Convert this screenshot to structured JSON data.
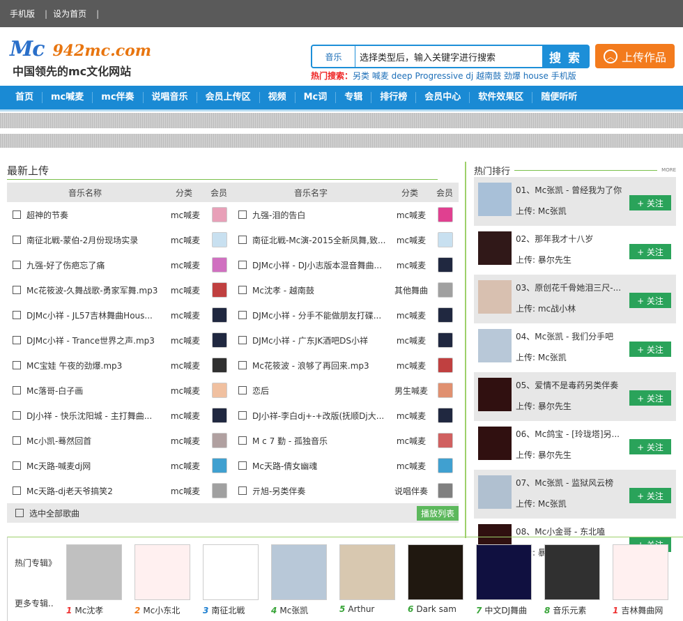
{
  "top": {
    "mobile": "手机版",
    "homepage": "设为首页",
    "sep": "|"
  },
  "logo": {
    "mc": "Mc",
    "domain": "942mc.com",
    "slogan": "中国领先的mc文化网站"
  },
  "search": {
    "type": "音乐",
    "value": "选择类型后，输入关键字进行搜索",
    "button": "搜 索"
  },
  "hot": {
    "label": "热门搜索：",
    "terms": "另类 喊麦 deep Progressive dj 越南鼓 劲爆 house 手机版"
  },
  "upload": {
    "label": "上传作品",
    "icon": "up-arrow-icon"
  },
  "nav": [
    "首页",
    "mc喊麦",
    "mc伴奏",
    "说唱音乐",
    "会员上传区",
    "视频",
    "Mc词",
    "专辑",
    "排行榜",
    "会员中心",
    "软件效果区",
    "随便听听"
  ],
  "latest": {
    "title": "最新上传",
    "headers": {
      "name1": "音乐名称",
      "cat1": "分类",
      "member1": "会员",
      "name2": "音乐名字",
      "cat2": "分类",
      "member2": "会员"
    },
    "rows": [
      {
        "l": "超神的节奏",
        "lc": "mc喊麦",
        "r": "九强-泪的告白",
        "rc": "mc喊麦"
      },
      {
        "l": "南征北戦-蒙伯-2月份现场实录",
        "lc": "mc喊麦",
        "r": "南征北戦-Mc演-2015全新凤舞,致...",
        "rc": "mc喊麦"
      },
      {
        "l": "九强-好了伤疤忘了痛",
        "lc": "mc喊麦",
        "r": "DJMc小祥 - DJ小志版本混音舞曲...",
        "rc": "mc喊麦"
      },
      {
        "l": "Mc花筱波-久舞战歌-勇家军舞.mp3",
        "lc": "mc喊麦",
        "r": "Mc沈孝 - 越南鼓",
        "rc": "其他舞曲"
      },
      {
        "l": "DJMc小祥 - JL57吉林舞曲Hous...",
        "lc": "mc喊麦",
        "r": "DJMc小祥 - 分手不能做朋友打碟...",
        "rc": "mc喊麦"
      },
      {
        "l": "DJMc小祥 - Trance世界之声.mp3",
        "lc": "mc喊麦",
        "r": "DJMc小祥 - 广东JK酒吧DS小祥",
        "rc": "mc喊麦"
      },
      {
        "l": "MC宝娃 午夜的劲爆.mp3",
        "lc": "mc喊麦",
        "r": "Mc花筱波 - 浪够了再回来.mp3",
        "rc": "mc喊麦"
      },
      {
        "l": "Mc落哥-白子画",
        "lc": "mc喊麦",
        "r": "恋后",
        "rc": "男生喊麦"
      },
      {
        "l": "DJ小祥 - 快乐沈阳城 - 主打舞曲...",
        "lc": "mc喊麦",
        "r": "DJ小祥-李白dj+-+改版(抚顺Dj大...",
        "rc": "mc喊麦"
      },
      {
        "l": "Mc小凯-蓦然回首",
        "lc": "mc喊麦",
        "r": "M c 7 勤 - 孤独音乐",
        "rc": "mc喊麦"
      },
      {
        "l": "Mc天路-喊麦dj网",
        "lc": "mc喊麦",
        "r": "Mc天路-倩女幽魂",
        "rc": "mc喊麦"
      },
      {
        "l": "Mc天路-dj老天爷搞笑2",
        "lc": "mc喊麦",
        "r": "亓旭-另类伴奏",
        "rc": "说唱伴奏"
      }
    ],
    "select_all": "选中全部歌曲",
    "playlist": "播放列表"
  },
  "ranking": {
    "title": "热门排行",
    "more": "MORE",
    "items": [
      {
        "title": "01、Mc张凯 - 曾经我为了你",
        "user": "上传: Mc张凯",
        "follow": "+ 关注"
      },
      {
        "title": "02、那年我才十八岁",
        "user": "上传: 暴尔先生",
        "follow": "+ 关注"
      },
      {
        "title": "03、原创花千骨她泪三尺-...",
        "user": "上传: mc战小林",
        "follow": "+ 关注"
      },
      {
        "title": "04、Mc张凯 - 我们分手吧",
        "user": "上传: Mc张凯",
        "follow": "+ 关注"
      },
      {
        "title": "05、爱情不是毒药另类伴奏",
        "user": "上传: 暴尔先生",
        "follow": "+ 关注"
      },
      {
        "title": "06、Mc鸽宝 - [玲珑塔]另...",
        "user": "上传: 暴尔先生",
        "follow": "+ 关注"
      },
      {
        "title": "07、Mc张凯 - 监狱风云榜",
        "user": "上传: Mc张凯",
        "follow": "+ 关注"
      },
      {
        "title": "08、Mc小金哥 - 东北嗑",
        "user": "上传: 暴尔先生",
        "follow": "+ 关注"
      }
    ]
  },
  "albums": {
    "hot_label": "热门专辑》",
    "more_label": "更多专辑..",
    "items": [
      {
        "num": "1",
        "name": "Mc沈孝",
        "color": "#e33"
      },
      {
        "num": "2",
        "name": "Mc小东北",
        "color": "#f07a1a"
      },
      {
        "num": "3",
        "name": "南征北戦",
        "color": "#1d7fd0"
      },
      {
        "num": "4",
        "name": "Mc张凯",
        "color": "#3aa53a"
      },
      {
        "num": "5",
        "name": "Arthur",
        "color": "#3aa53a"
      },
      {
        "num": "6",
        "name": "Dark sam",
        "color": "#3aa53a"
      },
      {
        "num": "7",
        "name": "中文DJ舞曲",
        "color": "#3aa53a"
      },
      {
        "num": "8",
        "name": "音乐元素",
        "color": "#3aa53a"
      },
      {
        "num": "1",
        "name": "吉林舞曲网",
        "color": "#e33"
      }
    ]
  }
}
